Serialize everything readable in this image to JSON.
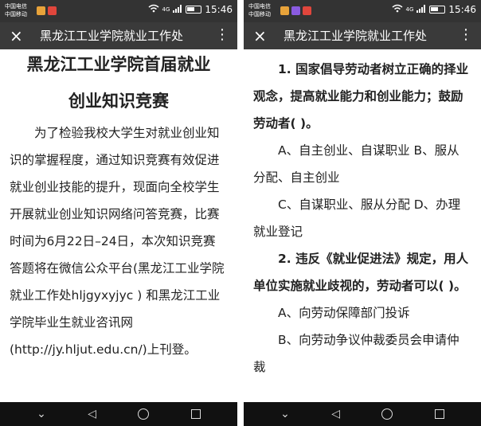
{
  "left_screen": {
    "status": {
      "carrier_1": "中国电信",
      "carrier_2": "中国移动",
      "network": "4G",
      "time": "15:46"
    },
    "app_bar": {
      "close_icon": "×",
      "title": "黑龙江工业学院就业工作处",
      "menu_icon": "⋮"
    },
    "article": {
      "title_line1": "黑龙江工业学院首届就业",
      "title_line2": "创业知识竞赛",
      "paragraph": "为了检验我校大学生对就业创业知识的掌握程度，通过知识竞赛有效促进就业创业技能的提升，现面向全校学生开展就业创业知识网络问答竞赛，比赛时间为6月22日–24日，本次知识竞赛答题将在微信公众平台(黑龙江工业学院就业工作处hljgyxyjyc ) 和黑龙江工业学院毕业生就业咨讯网",
      "url_line": "(http://jy.hljut.edu.cn/)上刊登。"
    },
    "nav": {
      "collapse_icon": "⌄",
      "back_icon": "◁",
      "home_icon": "○",
      "recent_icon": "□"
    }
  },
  "right_screen": {
    "status": {
      "carrier_1": "中国电信",
      "carrier_2": "中国移动",
      "network": "4G",
      "time": "15:46"
    },
    "app_bar": {
      "close_icon": "×",
      "title": "黑龙江工业学院就业工作处",
      "menu_icon": "⋮"
    },
    "quiz": {
      "q1": "1. 国家倡导劳动者树立正确的择业观念，提高就业能力和创业能力；鼓励劳动者(   )。",
      "q1_opt_ab": "A、自主创业、自谋职业    B、服从分配、自主创业",
      "q1_opt_cd": "C、自谋职业、服从分配    D、办理就业登记",
      "q2": "2. 违反《就业促进法》规定，用人单位实施就业歧视的，劳动者可以(   )。",
      "q2_opt_a": "A、向劳动保障部门投诉",
      "q2_opt_b": "B、向劳动争议仲裁委员会申请仲裁"
    },
    "nav": {
      "collapse_icon": "⌄",
      "back_icon": "◁",
      "home_icon": "○",
      "recent_icon": "□"
    }
  },
  "colors": {
    "status_bar": "#333333",
    "app_bar": "#3a3a3a",
    "nav_bar": "#111111",
    "text": "#222222"
  }
}
